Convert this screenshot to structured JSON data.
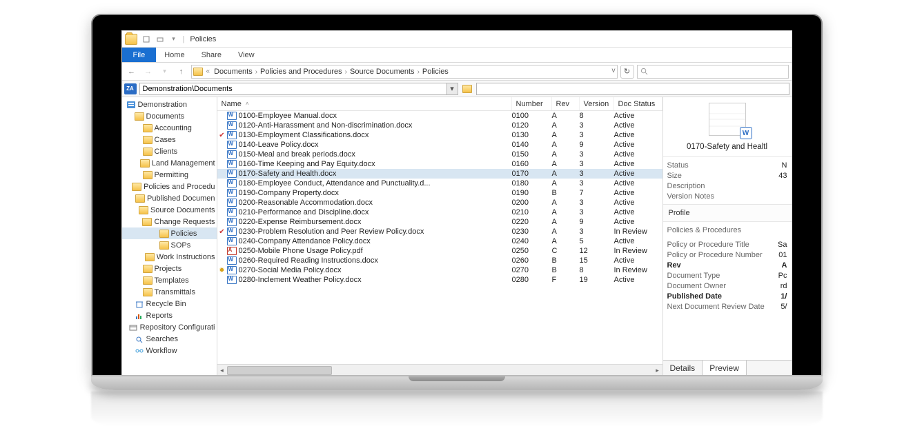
{
  "title": "Policies",
  "ribbon": {
    "file": "File",
    "home": "Home",
    "share": "Share",
    "view": "View"
  },
  "breadcrumb": {
    "prefix": "«",
    "items": [
      "Documents",
      "Policies and Procedures",
      "Source Documents",
      "Policies"
    ]
  },
  "path_input": "Demonstration\\Documents",
  "tree": [
    {
      "indent": 0,
      "label": "Demonstration",
      "icon": "root"
    },
    {
      "indent": 1,
      "label": "Documents",
      "icon": "folder"
    },
    {
      "indent": 2,
      "label": "Accounting",
      "icon": "folder"
    },
    {
      "indent": 2,
      "label": "Cases",
      "icon": "folder"
    },
    {
      "indent": 2,
      "label": "Clients",
      "icon": "folder"
    },
    {
      "indent": 2,
      "label": "Land Management",
      "icon": "folder"
    },
    {
      "indent": 2,
      "label": "Permitting",
      "icon": "folder"
    },
    {
      "indent": 2,
      "label": "Policies and Procedu",
      "icon": "folder"
    },
    {
      "indent": 3,
      "label": "Published Documen",
      "icon": "folder"
    },
    {
      "indent": 3,
      "label": "Source Documents",
      "icon": "folder"
    },
    {
      "indent": 4,
      "label": "Change Requests",
      "icon": "folder"
    },
    {
      "indent": 4,
      "label": "Policies",
      "icon": "folder",
      "selected": true
    },
    {
      "indent": 4,
      "label": "SOPs",
      "icon": "folder"
    },
    {
      "indent": 4,
      "label": "Work Instructions",
      "icon": "folder"
    },
    {
      "indent": 2,
      "label": "Projects",
      "icon": "folder"
    },
    {
      "indent": 2,
      "label": "Templates",
      "icon": "folder"
    },
    {
      "indent": 2,
      "label": "Transmittals",
      "icon": "folder"
    },
    {
      "indent": 1,
      "label": "Recycle Bin",
      "icon": "recycle"
    },
    {
      "indent": 1,
      "label": "Reports",
      "icon": "reports"
    },
    {
      "indent": 1,
      "label": "Repository Configurati",
      "icon": "config"
    },
    {
      "indent": 1,
      "label": "Searches",
      "icon": "search"
    },
    {
      "indent": 1,
      "label": "Workflow",
      "icon": "workflow"
    }
  ],
  "columns": {
    "name": "Name",
    "number": "Number",
    "rev": "Rev",
    "version": "Version",
    "status": "Doc Status"
  },
  "rows": [
    {
      "mark": "",
      "name": "0100-Employee Manual.docx",
      "num": "0100",
      "rev": "A",
      "ver": "8",
      "stat": "Active",
      "type": "docx"
    },
    {
      "mark": "",
      "name": "0120-Anti-Harassment and Non-discrimination.docx",
      "num": "0120",
      "rev": "A",
      "ver": "3",
      "stat": "Active",
      "type": "docx"
    },
    {
      "mark": "check",
      "name": "0130-Employment Classifications.docx",
      "num": "0130",
      "rev": "A",
      "ver": "3",
      "stat": "Active",
      "type": "docx"
    },
    {
      "mark": "",
      "name": "0140-Leave Policy.docx",
      "num": "0140",
      "rev": "A",
      "ver": "9",
      "stat": "Active",
      "type": "docx"
    },
    {
      "mark": "",
      "name": "0150-Meal and break periods.docx",
      "num": "0150",
      "rev": "A",
      "ver": "3",
      "stat": "Active",
      "type": "docx"
    },
    {
      "mark": "",
      "name": "0160-Time Keeping and Pay Equity.docx",
      "num": "0160",
      "rev": "A",
      "ver": "3",
      "stat": "Active",
      "type": "docx"
    },
    {
      "mark": "",
      "name": "0170-Safety and Health.docx",
      "num": "0170",
      "rev": "A",
      "ver": "3",
      "stat": "Active",
      "type": "docx",
      "selected": true
    },
    {
      "mark": "",
      "name": "0180-Employee Conduct, Attendance and Punctuality.d...",
      "num": "0180",
      "rev": "A",
      "ver": "3",
      "stat": "Active",
      "type": "docx"
    },
    {
      "mark": "",
      "name": "0190-Company Property.docx",
      "num": "0190",
      "rev": "B",
      "ver": "7",
      "stat": "Active",
      "type": "docx"
    },
    {
      "mark": "",
      "name": "0200-Reasonable Accommodation.docx",
      "num": "0200",
      "rev": "A",
      "ver": "3",
      "stat": "Active",
      "type": "docx"
    },
    {
      "mark": "",
      "name": "0210-Performance and Discipline.docx",
      "num": "0210",
      "rev": "A",
      "ver": "3",
      "stat": "Active",
      "type": "docx"
    },
    {
      "mark": "",
      "name": "0220-Expense Reimbursement.docx",
      "num": "0220",
      "rev": "A",
      "ver": "9",
      "stat": "Active",
      "type": "docx"
    },
    {
      "mark": "check",
      "name": "0230-Problem Resolution and Peer Review Policy.docx",
      "num": "0230",
      "rev": "A",
      "ver": "3",
      "stat": "In Review",
      "type": "docx"
    },
    {
      "mark": "",
      "name": "0240-Company Attendance Policy.docx",
      "num": "0240",
      "rev": "A",
      "ver": "5",
      "stat": "Active",
      "type": "docx"
    },
    {
      "mark": "",
      "name": "0250-Mobile Phone Usage Policy.pdf",
      "num": "0250",
      "rev": "C",
      "ver": "12",
      "stat": "In Review",
      "type": "pdf"
    },
    {
      "mark": "",
      "name": "0260-Required Reading Instructions.docx",
      "num": "0260",
      "rev": "B",
      "ver": "15",
      "stat": "Active",
      "type": "docx"
    },
    {
      "mark": "gear",
      "name": "0270-Social Media Policy.docx",
      "num": "0270",
      "rev": "B",
      "ver": "8",
      "stat": "In Review",
      "type": "docx"
    },
    {
      "mark": "",
      "name": "0280-Inclement Weather Policy.docx",
      "num": "0280",
      "rev": "F",
      "ver": "19",
      "stat": "Active",
      "type": "docx"
    }
  ],
  "preview": {
    "title": "0170-Safety and Healtl",
    "meta": [
      {
        "k": "Status",
        "v": "N"
      },
      {
        "k": "Size",
        "v": "43"
      },
      {
        "k": "Description",
        "v": ""
      },
      {
        "k": "Version Notes",
        "v": ""
      }
    ],
    "profile_header": "Profile",
    "profile_section": "Policies & Procedures",
    "profile": [
      {
        "k": "Policy or Procedure Title",
        "v": "Sa",
        "bold": false
      },
      {
        "k": "Policy or Procedure Number",
        "v": "01",
        "bold": false
      },
      {
        "k": "Rev",
        "v": "A",
        "bold": true
      },
      {
        "k": "Document Type",
        "v": "Pc",
        "bold": false
      },
      {
        "k": "Document Owner",
        "v": "rd",
        "bold": false
      },
      {
        "k": "Published Date",
        "v": "1/",
        "bold": true
      },
      {
        "k": "Next Document Review Date",
        "v": "5/",
        "bold": false
      }
    ],
    "tabs": {
      "details": "Details",
      "preview": "Preview"
    }
  }
}
